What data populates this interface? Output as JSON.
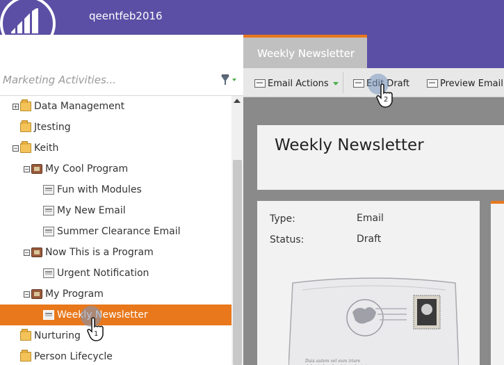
{
  "header": {
    "workspace_name": "qeentfeb2016",
    "logo": "marketo-logo"
  },
  "left_panel": {
    "search_placeholder": "Marketing Activities...",
    "filter_icon": "filter-icon",
    "tree": [
      {
        "label": "Data Management",
        "type": "folder",
        "expander": "+",
        "depth": 0
      },
      {
        "label": "Jtesting",
        "type": "folder",
        "expander": "",
        "depth": 0
      },
      {
        "label": "Keith",
        "type": "folder",
        "expander": "-",
        "depth": 0
      },
      {
        "label": "My Cool Program",
        "type": "program",
        "expander": "-",
        "depth": 1
      },
      {
        "label": "Fun with Modules",
        "type": "email",
        "expander": "",
        "depth": 2
      },
      {
        "label": "My New Email",
        "type": "email",
        "expander": "",
        "depth": 2
      },
      {
        "label": "Summer Clearance Email",
        "type": "email",
        "expander": "",
        "depth": 2
      },
      {
        "label": "Now This is a Program",
        "type": "program",
        "expander": "-",
        "depth": 1
      },
      {
        "label": "Urgent Notification",
        "type": "email",
        "expander": "",
        "depth": 2
      },
      {
        "label": "My Program",
        "type": "program",
        "expander": "-",
        "depth": 1
      },
      {
        "label": "Weekly Newsletter",
        "type": "email",
        "expander": "",
        "depth": 2,
        "selected": true
      },
      {
        "label": "Nurturing",
        "type": "folder",
        "expander": "",
        "depth": 0
      },
      {
        "label": "Person Lifecycle",
        "type": "folder",
        "expander": "",
        "depth": 0
      }
    ]
  },
  "tab": {
    "label": "Weekly Newsletter"
  },
  "toolbar": {
    "email_actions": "Email Actions",
    "edit_draft": "Edit Draft",
    "preview_email": "Preview Email"
  },
  "email": {
    "title": "Weekly Newsletter",
    "type_label": "Type:",
    "type_value": "Email",
    "status_label": "Status:",
    "status_value": "Draft"
  },
  "annotations": {
    "step_1": "1",
    "step_2": "2"
  },
  "colors": {
    "brand_purple": "#5b4fa5",
    "accent_orange": "#e8781b",
    "filter_green": "#4ab04a"
  }
}
